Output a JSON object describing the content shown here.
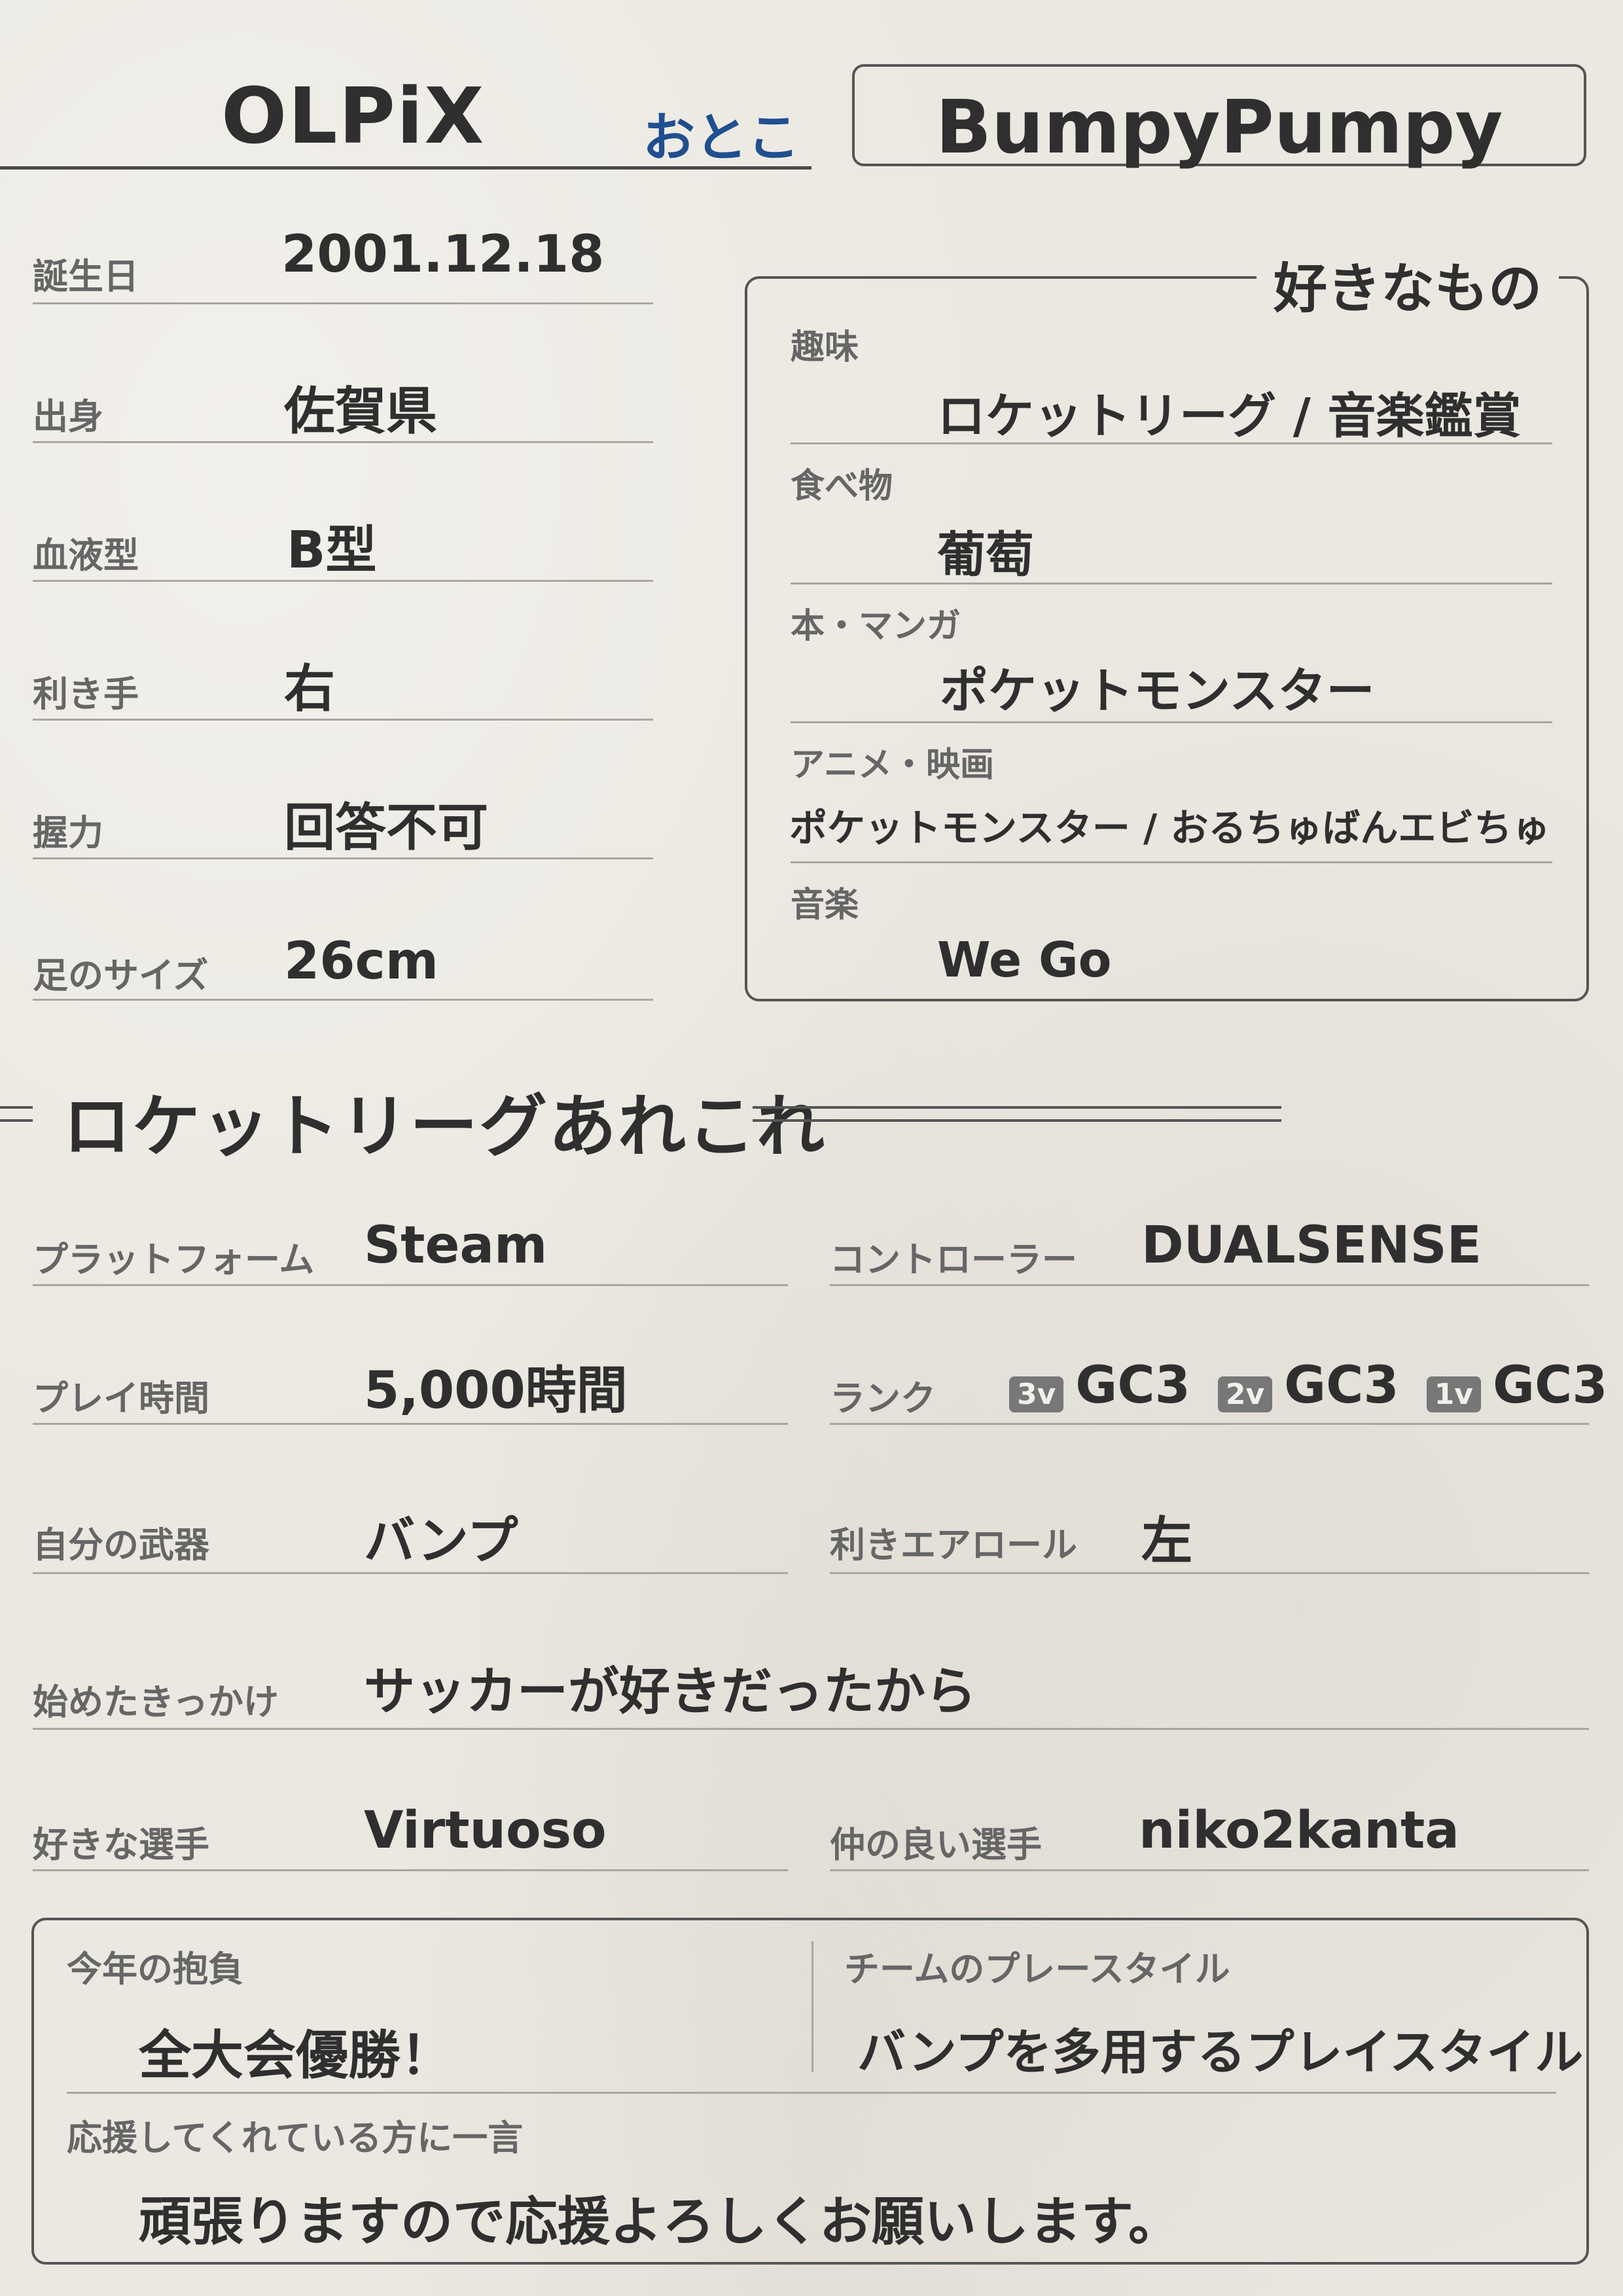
{
  "header": {
    "team": "OLPiX",
    "gender": "おとこ",
    "player": "BumpyPumpy"
  },
  "profile": [
    {
      "label": "誕生日",
      "value": "2001.12.18"
    },
    {
      "label": "出身",
      "value": "佐賀県"
    },
    {
      "label": "血液型",
      "value": "B型"
    },
    {
      "label": "利き手",
      "value": "右"
    },
    {
      "label": "握力",
      "value": "回答不可"
    },
    {
      "label": "足のサイズ",
      "value": "26cm"
    }
  ],
  "favorites": {
    "title": "好きなもの",
    "items": [
      {
        "label": "趣味",
        "value": "ロケットリーグ / 音楽鑑賞"
      },
      {
        "label": "食べ物",
        "value": "葡萄"
      },
      {
        "label": "本・マンガ",
        "value": "ポケットモンスター"
      },
      {
        "label": "アニメ・映画",
        "value": "ポケットモンスター / おるちゅばんエビちゅ"
      },
      {
        "label": "音楽",
        "value": "We Go"
      }
    ]
  },
  "rl": {
    "title": "ロケットリーグあれこれ",
    "platform": {
      "label": "プラットフォーム",
      "value": "Steam"
    },
    "controller": {
      "label": "コントローラー",
      "value": "DUALSENSE"
    },
    "playtime": {
      "label": "プレイ時間",
      "value": "5,000時間"
    },
    "rank": {
      "label": "ランク",
      "items": [
        {
          "mode": "3v",
          "rank": "GC3"
        },
        {
          "mode": "2v",
          "rank": "GC3"
        },
        {
          "mode": "1v",
          "rank": "GC3"
        }
      ]
    },
    "weapon": {
      "label": "自分の武器",
      "value": "バンプ"
    },
    "air_roll": {
      "label": "利きエアロール",
      "value": "左"
    },
    "reason": {
      "label": "始めたきっかけ",
      "value": "サッカーが好きだったから"
    },
    "fav_player": {
      "label": "好きな選手",
      "value": "Virtuoso"
    },
    "friend": {
      "label": "仲の良い選手",
      "value": "niko2kanta"
    }
  },
  "bottom": {
    "goal": {
      "label": "今年の抱負",
      "value": "全大会優勝！"
    },
    "team_style": {
      "label": "チームのプレースタイル",
      "value": "バンプを多用するプレイスタイル"
    },
    "message": {
      "label": "応援してくれている方に一言",
      "value": "頑張りますので応援よろしくお願いします。"
    }
  }
}
